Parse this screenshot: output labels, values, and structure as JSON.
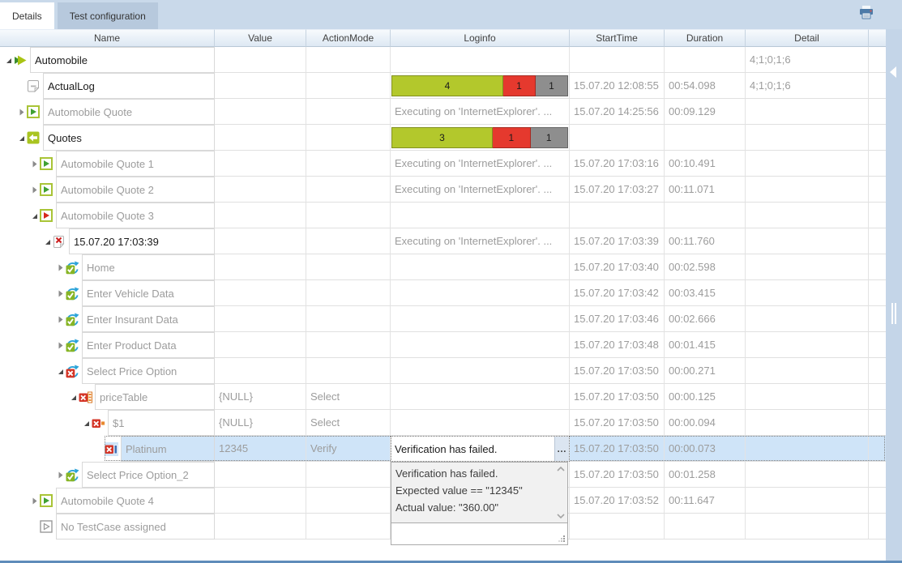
{
  "tabs": [
    {
      "label": "Details",
      "active": true
    },
    {
      "label": "Test configuration",
      "active": false
    }
  ],
  "toolbar": {
    "printer_icon": "printer"
  },
  "columns": [
    "Name",
    "Value",
    "ActionMode",
    "Loginfo",
    "StartTime",
    "Duration",
    "Detail"
  ],
  "colors": {
    "bar_green": "#b3c82c",
    "bar_red": "#e5392e",
    "bar_gray": "#8e8e8e",
    "selection": "#cfe4f8",
    "tab_bar": "#c9d9ea",
    "accent_lime": "#a9c414",
    "fail_red": "#d43527",
    "rerun_blue": "#2ba3d8"
  },
  "rows": [
    {
      "name": "Automobile",
      "level": 0,
      "expander": "expanded",
      "icon": "testlist-run-icon",
      "name_color": "dark",
      "value": "",
      "action": "",
      "loginfo": {
        "type": "none"
      },
      "start": "",
      "duration": "",
      "detail": "4;1;0;1;6",
      "selected": false
    },
    {
      "name": "ActualLog",
      "level": 1,
      "expander": "none",
      "icon": "log-document-icon",
      "name_color": "dark",
      "value": "",
      "action": "",
      "loginfo": {
        "type": "bar",
        "passed": 4,
        "failed": 1,
        "other": 1
      },
      "start": "15.07.20 12:08:55",
      "duration": "00:54.098",
      "detail": "4;1;0;1;6",
      "selected": false
    },
    {
      "name": "Automobile Quote",
      "level": 1,
      "expander": "collapsed",
      "icon": "testcase-pass-icon",
      "name_color": "gray",
      "value": "",
      "action": "",
      "loginfo": {
        "type": "text",
        "text": "Executing on 'InternetExplorer'. ..."
      },
      "start": "15.07.20 14:25:56",
      "duration": "00:09.129",
      "detail": "",
      "selected": false
    },
    {
      "name": "Quotes",
      "level": 1,
      "expander": "expanded",
      "icon": "folder-return-icon",
      "name_color": "dark",
      "value": "",
      "action": "",
      "loginfo": {
        "type": "bar",
        "passed": 3,
        "failed": 1,
        "other": 1
      },
      "start": "",
      "duration": "",
      "detail": "",
      "selected": false
    },
    {
      "name": "Automobile Quote 1",
      "level": 2,
      "expander": "collapsed",
      "icon": "testcase-pass-icon",
      "name_color": "gray",
      "value": "",
      "action": "",
      "loginfo": {
        "type": "text",
        "text": "Executing on 'InternetExplorer'. ..."
      },
      "start": "15.07.20 17:03:16",
      "duration": "00:10.491",
      "detail": "",
      "selected": false
    },
    {
      "name": "Automobile Quote 2",
      "level": 2,
      "expander": "collapsed",
      "icon": "testcase-pass-icon",
      "name_color": "gray",
      "value": "",
      "action": "",
      "loginfo": {
        "type": "text",
        "text": "Executing on 'InternetExplorer'. ..."
      },
      "start": "15.07.20 17:03:27",
      "duration": "00:11.071",
      "detail": "",
      "selected": false
    },
    {
      "name": "Automobile Quote 3",
      "level": 2,
      "expander": "expanded",
      "icon": "testcase-fail-icon",
      "name_color": "gray",
      "value": "",
      "action": "",
      "loginfo": {
        "type": "none"
      },
      "start": "",
      "duration": "",
      "detail": "",
      "selected": false
    },
    {
      "name": "15.07.20 17:03:39",
      "level": 3,
      "expander": "expanded",
      "icon": "log-failed-icon",
      "name_color": "dark",
      "value": "",
      "action": "",
      "loginfo": {
        "type": "text",
        "text": "Executing on 'InternetExplorer'. ..."
      },
      "start": "15.07.20 17:03:39",
      "duration": "00:11.760",
      "detail": "",
      "selected": false
    },
    {
      "name": "Home",
      "level": 4,
      "expander": "collapsed",
      "icon": "step-passed-icon",
      "name_color": "gray",
      "value": "",
      "action": "",
      "loginfo": {
        "type": "none"
      },
      "start": "15.07.20 17:03:40",
      "duration": "00:02.598",
      "detail": "",
      "selected": false
    },
    {
      "name": "Enter Vehicle Data",
      "level": 4,
      "expander": "collapsed",
      "icon": "step-passed-icon",
      "name_color": "gray",
      "value": "",
      "action": "",
      "loginfo": {
        "type": "none"
      },
      "start": "15.07.20 17:03:42",
      "duration": "00:03.415",
      "detail": "",
      "selected": false
    },
    {
      "name": "Enter Insurant Data",
      "level": 4,
      "expander": "collapsed",
      "icon": "step-passed-icon",
      "name_color": "gray",
      "value": "",
      "action": "",
      "loginfo": {
        "type": "none"
      },
      "start": "15.07.20 17:03:46",
      "duration": "00:02.666",
      "detail": "",
      "selected": false
    },
    {
      "name": "Enter Product Data",
      "level": 4,
      "expander": "collapsed",
      "icon": "step-passed-icon",
      "name_color": "gray",
      "value": "",
      "action": "",
      "loginfo": {
        "type": "none"
      },
      "start": "15.07.20 17:03:48",
      "duration": "00:01.415",
      "detail": "",
      "selected": false
    },
    {
      "name": "Select Price Option",
      "level": 4,
      "expander": "expanded",
      "icon": "step-failed-icon",
      "name_color": "gray",
      "value": "",
      "action": "",
      "loginfo": {
        "type": "none"
      },
      "start": "15.07.20 17:03:50",
      "duration": "00:00.271",
      "detail": "",
      "selected": false
    },
    {
      "name": "priceTable",
      "level": 5,
      "expander": "expanded",
      "icon": "module-failed-icon",
      "name_color": "gray",
      "value": "{NULL}",
      "action": "Select",
      "loginfo": {
        "type": "none"
      },
      "start": "15.07.20 17:03:50",
      "duration": "00:00.125",
      "detail": "",
      "selected": false
    },
    {
      "name": "$1",
      "level": 6,
      "expander": "expanded",
      "icon": "row-failed-icon",
      "name_color": "gray",
      "value": "{NULL}",
      "action": "Select",
      "loginfo": {
        "type": "none"
      },
      "start": "15.07.20 17:03:50",
      "duration": "00:00.094",
      "detail": "",
      "selected": false
    },
    {
      "name": "Platinum",
      "level": 7,
      "expander": "none",
      "icon": "cell-failed-icon",
      "name_color": "gray",
      "value": "12345",
      "action": "Verify",
      "loginfo": {
        "type": "editor"
      },
      "start": "15.07.20 17:03:50",
      "duration": "00:00.073",
      "detail": "",
      "selected": true
    },
    {
      "name": "Select Price Option_2",
      "level": 4,
      "expander": "collapsed",
      "icon": "step-passed-icon",
      "name_color": "gray",
      "value": "",
      "action": "",
      "loginfo": {
        "type": "none"
      },
      "start": "15.07.20 17:03:50",
      "duration": "00:01.258",
      "detail": "",
      "selected": false
    },
    {
      "name": "Automobile Quote 4",
      "level": 2,
      "expander": "collapsed",
      "icon": "testcase-pass-icon",
      "name_color": "gray",
      "value": "",
      "action": "",
      "loginfo": {
        "type": "none"
      },
      "start": "15.07.20 17:03:52",
      "duration": "00:11.647",
      "detail": "",
      "selected": false
    },
    {
      "name": "No TestCase assigned",
      "level": 2,
      "expander": "none",
      "icon": "testcase-empty-icon",
      "name_color": "gray",
      "value": "",
      "action": "",
      "loginfo": {
        "type": "none"
      },
      "start": "",
      "duration": "",
      "detail": "",
      "selected": false
    }
  ],
  "editor": {
    "text": "Verification has failed.",
    "button": "…"
  },
  "popup": {
    "lines": [
      "Verification has failed.",
      "Expected value == \"12345\"",
      "Actual value: \"360.00\""
    ]
  }
}
